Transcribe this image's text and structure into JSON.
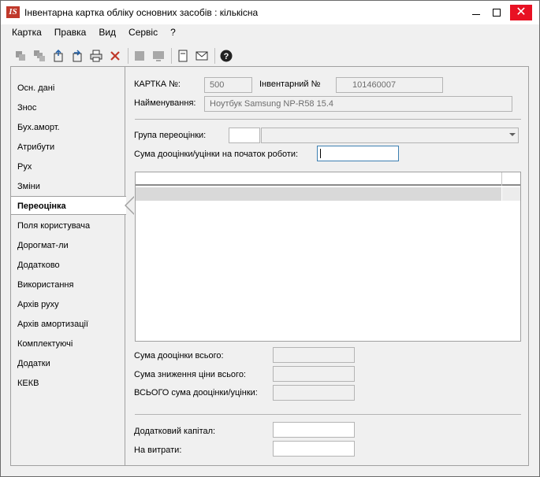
{
  "window": {
    "logo_text": "IS",
    "title": "Інвентарна картка обліку основних засобів  : кількісна",
    "minimize_icon": "minimize-icon",
    "maximize_icon": "maximize-icon",
    "close_icon": "close-icon",
    "close_color": "#e81123"
  },
  "menu": [
    "Картка",
    "Правка",
    "Вид",
    "Сервіс",
    "?"
  ],
  "toolbar": {
    "icons": [
      "copy-icon",
      "copy-multiple-icon",
      "import-icon",
      "export-icon",
      "print-icon",
      "delete-icon",
      "square-gray-icon",
      "screen-icon",
      "document-icon",
      "mail-icon",
      "help-icon"
    ]
  },
  "nav": {
    "items": [
      {
        "label": "Осн. дані",
        "active": false
      },
      {
        "label": "Знос",
        "active": false
      },
      {
        "label": "Бух.аморт.",
        "active": false
      },
      {
        "label": "Атрибути",
        "active": false
      },
      {
        "label": "Рух",
        "active": false
      },
      {
        "label": "Зміни",
        "active": false
      },
      {
        "label": "Переоцінка",
        "active": true
      },
      {
        "label": "Поля користувача",
        "active": false
      },
      {
        "label": "Дорогмат-ли",
        "active": false
      },
      {
        "label": "Додатково",
        "active": false
      },
      {
        "label": "Використання",
        "active": false
      },
      {
        "label": "Архів руху",
        "active": false
      },
      {
        "label": "Архів амортизації",
        "active": false
      },
      {
        "label": "Комплектуючі",
        "active": false
      },
      {
        "label": "Додатки",
        "active": false
      },
      {
        "label": "КЕКВ",
        "active": false
      }
    ]
  },
  "card": {
    "card_no_label": "КАРТКА №:",
    "card_no_value": "500",
    "inv_no_label": "Інвентарний №",
    "inv_no_value": "101460007",
    "name_label": "Найменування:",
    "name_value": "Ноутбук Samsung NP-R58 15.4"
  },
  "revaluation": {
    "group_label": "Група переоцінки:",
    "group_code": "",
    "group_value": "",
    "sum_start_label": "Сума дооцінки/уцінки на початок роботи:",
    "sum_start_value": ""
  },
  "totals": {
    "revalue_total_label": "Сума дооцінки всього:",
    "revalue_total_value": "",
    "decrease_total_label": "Сума зниження ціни всього:",
    "decrease_total_value": "",
    "grand_total_label": "ВСЬОГО сума дооцінки/уцінки:",
    "grand_total_value": ""
  },
  "capital": {
    "additional_label": "Додатковий капітал:",
    "additional_value": "",
    "expenses_label": "На витрати:",
    "expenses_value": ""
  }
}
